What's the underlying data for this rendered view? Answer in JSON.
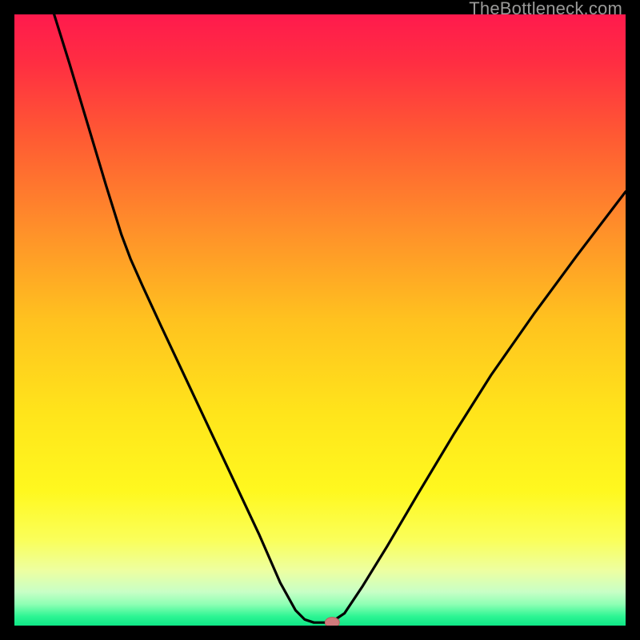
{
  "watermark": "TheBottleneck.com",
  "colors": {
    "gradient_stops": [
      {
        "offset": 0.0,
        "color": "#ff1a4d"
      },
      {
        "offset": 0.08,
        "color": "#ff2e42"
      },
      {
        "offset": 0.2,
        "color": "#ff5a33"
      },
      {
        "offset": 0.35,
        "color": "#ff8f2a"
      },
      {
        "offset": 0.5,
        "color": "#ffc21f"
      },
      {
        "offset": 0.65,
        "color": "#ffe41b"
      },
      {
        "offset": 0.78,
        "color": "#fff81f"
      },
      {
        "offset": 0.86,
        "color": "#faff5a"
      },
      {
        "offset": 0.91,
        "color": "#edffa1"
      },
      {
        "offset": 0.945,
        "color": "#c8ffc6"
      },
      {
        "offset": 0.965,
        "color": "#8effb4"
      },
      {
        "offset": 0.985,
        "color": "#2cf593"
      },
      {
        "offset": 1.0,
        "color": "#0fe686"
      }
    ],
    "curve": "#000000",
    "marker_fill": "#d07a7c",
    "marker_stroke": "#b85d5f"
  },
  "chart_data": {
    "type": "line",
    "title": "",
    "xlabel": "",
    "ylabel": "",
    "xlim": [
      0,
      100
    ],
    "ylim": [
      0,
      100
    ],
    "curve_points": [
      {
        "x": 6.5,
        "y": 100.0
      },
      {
        "x": 9.0,
        "y": 92.0
      },
      {
        "x": 12.0,
        "y": 82.0
      },
      {
        "x": 15.0,
        "y": 72.0
      },
      {
        "x": 17.5,
        "y": 64.0
      },
      {
        "x": 19.0,
        "y": 60.0
      },
      {
        "x": 21.0,
        "y": 55.5
      },
      {
        "x": 24.0,
        "y": 49.0
      },
      {
        "x": 28.0,
        "y": 40.5
      },
      {
        "x": 32.0,
        "y": 32.0
      },
      {
        "x": 36.0,
        "y": 23.5
      },
      {
        "x": 40.0,
        "y": 15.0
      },
      {
        "x": 43.5,
        "y": 7.0
      },
      {
        "x": 46.0,
        "y": 2.5
      },
      {
        "x": 47.5,
        "y": 1.0
      },
      {
        "x": 49.0,
        "y": 0.5
      },
      {
        "x": 51.0,
        "y": 0.5
      },
      {
        "x": 52.5,
        "y": 1.0
      },
      {
        "x": 54.0,
        "y": 2.0
      },
      {
        "x": 57.0,
        "y": 6.5
      },
      {
        "x": 61.0,
        "y": 13.0
      },
      {
        "x": 66.0,
        "y": 21.5
      },
      {
        "x": 72.0,
        "y": 31.5
      },
      {
        "x": 78.0,
        "y": 41.0
      },
      {
        "x": 85.0,
        "y": 51.0
      },
      {
        "x": 92.0,
        "y": 60.5
      },
      {
        "x": 100.0,
        "y": 71.0
      }
    ],
    "marker": {
      "x": 52.0,
      "y": 0.5
    }
  }
}
